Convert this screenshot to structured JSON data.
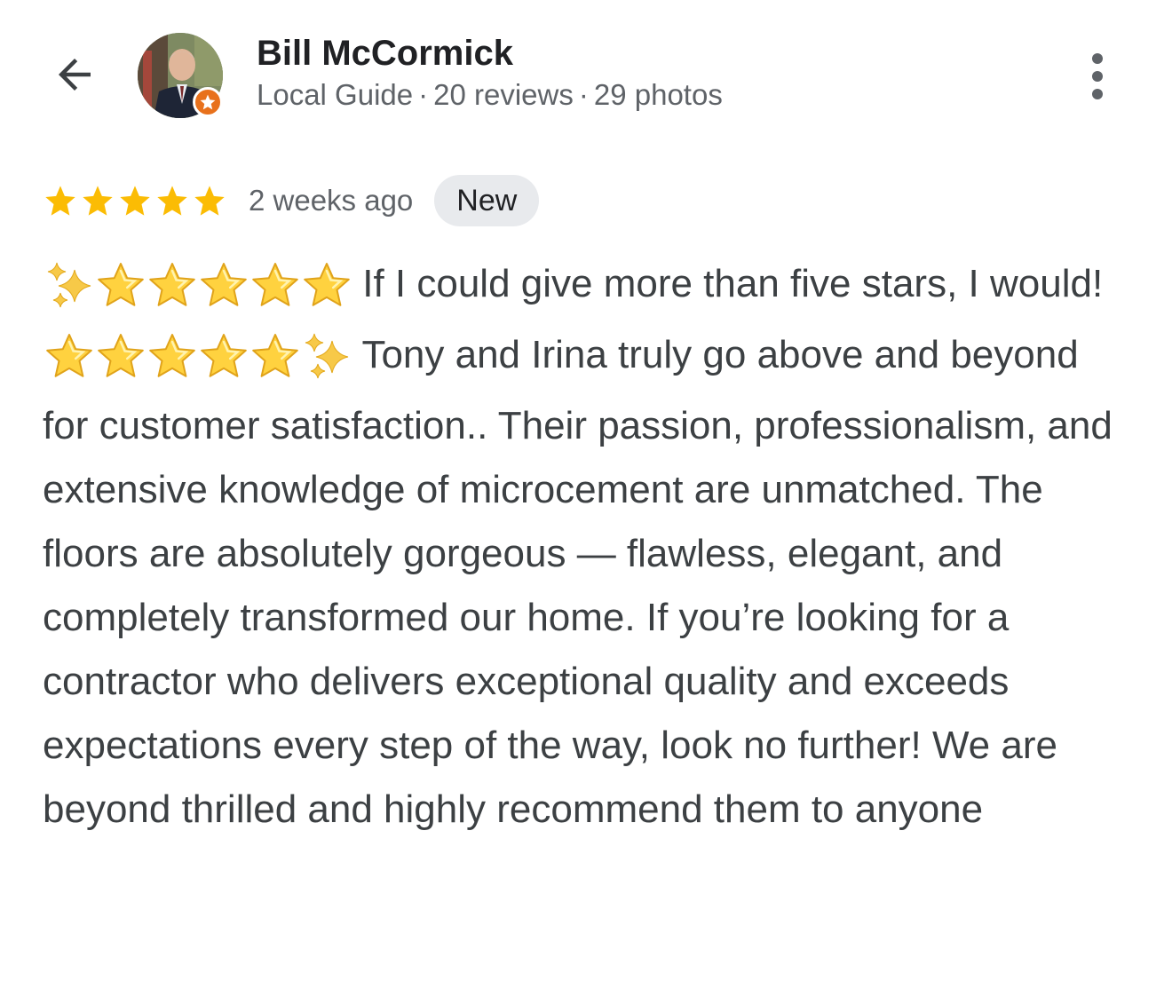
{
  "header": {
    "back_icon": "arrow-back-icon",
    "more_icon": "more-vert-icon"
  },
  "reviewer": {
    "name": "Bill McCormick",
    "guide_label": "Local Guide",
    "reviews": "20 reviews",
    "photos": "29 photos",
    "separator": "·",
    "badge_icon": "local-guide-star-icon",
    "badge_color": "#e8711c"
  },
  "review": {
    "rating": 5,
    "rating_max": 5,
    "star_color": "#fbbc04",
    "time_ago": "2 weeks ago",
    "badge": "New",
    "text_part1": "If I could give more than five stars, I would!",
    "text_part2": "Tony and Irina truly go above and beyond for customer satisfaction.. Their passion, professionalism, and extensive knowledge of microcement are unmatched. The floors are absolutely gorgeous — flawless, elegant, and completely transformed our home. If you’re looking for a contractor who delivers exceptional quality and exceeds expectations every step of the way, look no further! We are beyond thrilled and highly recommend them to anyone",
    "emoji_sequence_1": "✨⭐⭐⭐⭐⭐",
    "emoji_sequence_2": "⭐⭐⭐⭐⭐✨"
  }
}
